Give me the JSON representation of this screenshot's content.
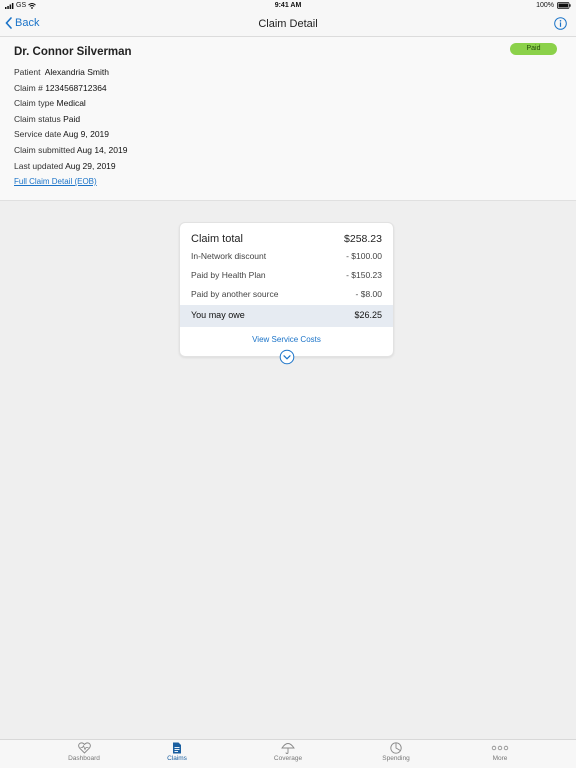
{
  "status_bar": {
    "carrier": "GS",
    "time": "9:41 AM",
    "battery": "100%"
  },
  "nav": {
    "back_label": "Back",
    "title": "Claim Detail"
  },
  "claim": {
    "provider": "Dr. Connor Silverman",
    "status_badge": "Paid",
    "rows": [
      {
        "label": "Patient",
        "value": "Alexandria Smith"
      },
      {
        "label": "Claim #",
        "value": "1234568712364"
      },
      {
        "label": "Claim type",
        "value": "Medical"
      },
      {
        "label": "Claim status",
        "value": "Paid"
      },
      {
        "label": "Service date",
        "value": "Aug 9, 2019"
      },
      {
        "label": "Claim submitted",
        "value": "Aug 14, 2019"
      },
      {
        "label": "Last updated",
        "value": "Aug 29, 2019"
      }
    ],
    "eob_link": "Full Claim Detail (EOB)"
  },
  "summary": {
    "total_label": "Claim total",
    "total_value": "$258.23",
    "lines": [
      {
        "label": "In-Network discount",
        "value": "- $100.00"
      },
      {
        "label": "Paid by Health Plan",
        "value": "- $150.23"
      },
      {
        "label": "Paid by another source",
        "value": "- $8.00"
      }
    ],
    "owe_label": "You may owe",
    "owe_value": "$26.25",
    "view_link": "View Service Costs"
  },
  "tabs": [
    {
      "label": "Dashboard",
      "icon": "heart-pulse-icon"
    },
    {
      "label": "Claims",
      "icon": "document-icon",
      "active": true
    },
    {
      "label": "Coverage",
      "icon": "umbrella-icon"
    },
    {
      "label": "Spending",
      "icon": "pie-chart-icon"
    },
    {
      "label": "More",
      "icon": "ellipsis-icon"
    }
  ],
  "colors": {
    "accent": "#1a73c8",
    "paid_badge": "#8bd14a",
    "owe_highlight": "#e6ebf2",
    "active_tab": "#1a5fa0"
  }
}
